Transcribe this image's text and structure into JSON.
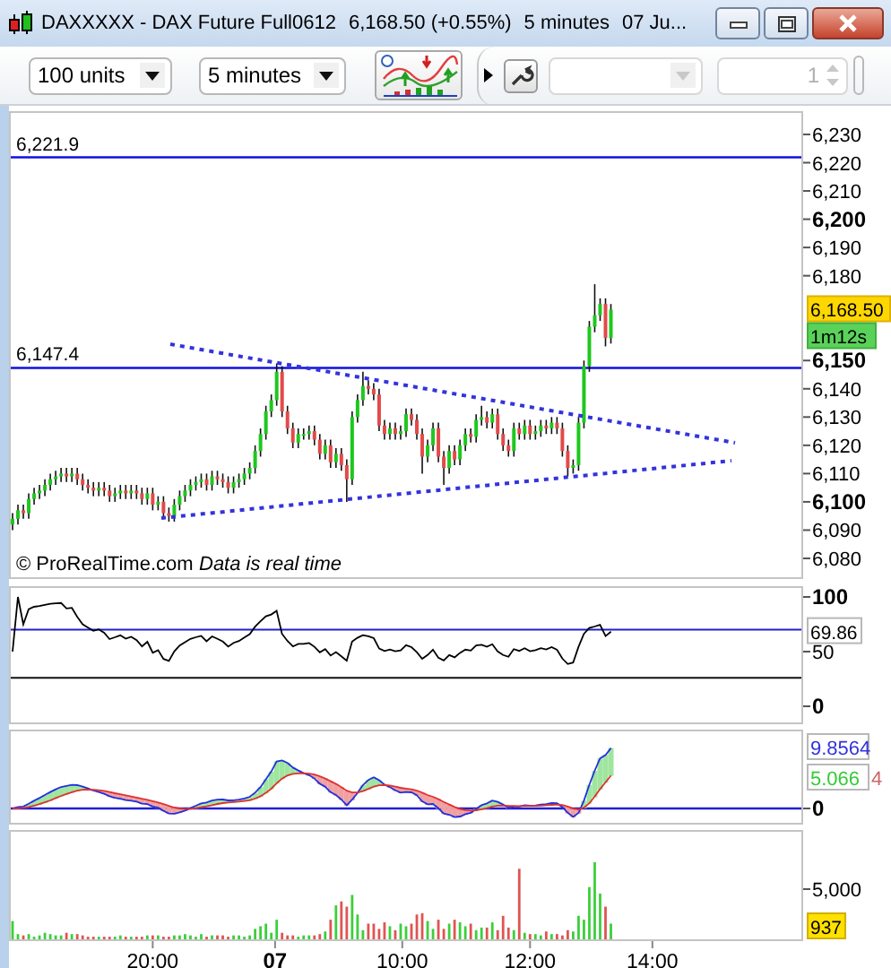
{
  "window": {
    "title": "DAXXXXX - DAX Future Full0612",
    "quote": "6,168.50 (+0.55%)",
    "timeframe": "5 minutes",
    "date": "07 Ju..."
  },
  "toolbar": {
    "units": "100 units",
    "period": "5 minutes",
    "style_dropdown": {
      "disabled": true
    },
    "quantity": {
      "value": "1",
      "disabled": true
    }
  },
  "price_chart": {
    "copyright": "© ProRealTime.com",
    "notice": "Data is real time",
    "last_price": "6,168.50",
    "countdown": "1m12s",
    "chart_data": {
      "type": "candlestick",
      "ylim": [
        6072.7,
        6237.6
      ],
      "categories": [
        null,
        null,
        null,
        null,
        null,
        null,
        null,
        null,
        null,
        null,
        null,
        null,
        null,
        null,
        null,
        null,
        null,
        null,
        null,
        null,
        null,
        null,
        null,
        null,
        null,
        null,
        null,
        null,
        null,
        null,
        null,
        null,
        null,
        null,
        null,
        null,
        null,
        null,
        null,
        null,
        null,
        null,
        null,
        null,
        null,
        null,
        null,
        null,
        null,
        null,
        null,
        null,
        null,
        null,
        null,
        null,
        null,
        null,
        null,
        null,
        null,
        null,
        null,
        null,
        null,
        null,
        null,
        null,
        null,
        null,
        null,
        null,
        null,
        null,
        null,
        null,
        null,
        null,
        null,
        null,
        null,
        null,
        null,
        null,
        null,
        null,
        null,
        null,
        null,
        null,
        null,
        null,
        null,
        null,
        null,
        null,
        null,
        null,
        null,
        null,
        null,
        null,
        null,
        null,
        null,
        null,
        null,
        null,
        null,
        null,
        null,
        null,
        null,
        null,
        null,
        null,
        null,
        null,
        null,
        null,
        null,
        null,
        null,
        null,
        null,
        null,
        null,
        null,
        null,
        null,
        null,
        null,
        null,
        null,
        null,
        null,
        null,
        null,
        null,
        null,
        null,
        null,
        null,
        null,
        null,
        null,
        null
      ],
      "ohlc": [
        [
          6092,
          6096,
          6090,
          6094
        ],
        [
          6094,
          6099,
          6092,
          6097
        ],
        [
          6097,
          6099,
          6094,
          6096
        ],
        [
          6096,
          6103,
          6094,
          6101
        ],
        [
          6101,
          6105,
          6099,
          6103
        ],
        [
          6103,
          6106,
          6101,
          6104
        ],
        [
          6104,
          6108,
          6102,
          6106
        ],
        [
          6106,
          6110,
          6104,
          6108
        ],
        [
          6108,
          6111,
          6106,
          6109
        ],
        [
          6109,
          6112,
          6107,
          6110
        ],
        [
          6110,
          6112,
          6107,
          6109
        ],
        [
          6109,
          6112,
          6107,
          6110
        ],
        [
          6110,
          6112,
          6106,
          6108
        ],
        [
          6108,
          6110,
          6104,
          6106
        ],
        [
          6106,
          6108,
          6103,
          6105
        ],
        [
          6105,
          6107,
          6102,
          6104
        ],
        [
          6104,
          6107,
          6102,
          6105
        ],
        [
          6105,
          6107,
          6102,
          6104
        ],
        [
          6104,
          6106,
          6100,
          6102
        ],
        [
          6102,
          6105,
          6100,
          6103
        ],
        [
          6103,
          6106,
          6101,
          6104
        ],
        [
          6104,
          6106,
          6101,
          6103
        ],
        [
          6103,
          6106,
          6101,
          6104
        ],
        [
          6104,
          6106,
          6101,
          6103
        ],
        [
          6103,
          6105,
          6099,
          6101
        ],
        [
          6101,
          6105,
          6099,
          6103
        ],
        [
          6103,
          6105,
          6097,
          6099
        ],
        [
          6099,
          6102,
          6097,
          6100
        ],
        [
          6100,
          6102,
          6094,
          6096
        ],
        [
          6096,
          6098,
          6093,
          6095
        ],
        [
          6095,
          6101,
          6093,
          6099
        ],
        [
          6099,
          6104,
          6097,
          6102
        ],
        [
          6102,
          6106,
          6100,
          6104
        ],
        [
          6104,
          6108,
          6102,
          6106
        ],
        [
          6106,
          6109,
          6104,
          6107
        ],
        [
          6107,
          6110,
          6105,
          6108
        ],
        [
          6108,
          6110,
          6104,
          6106
        ],
        [
          6106,
          6111,
          6104,
          6109
        ],
        [
          6109,
          6111,
          6106,
          6108
        ],
        [
          6108,
          6110,
          6105,
          6107
        ],
        [
          6107,
          6109,
          6103,
          6105
        ],
        [
          6105,
          6109,
          6103,
          6107
        ],
        [
          6107,
          6110,
          6105,
          6108
        ],
        [
          6108,
          6112,
          6106,
          6110
        ],
        [
          6110,
          6114,
          6108,
          6112
        ],
        [
          6112,
          6120,
          6110,
          6118
        ],
        [
          6118,
          6126,
          6116,
          6124
        ],
        [
          6124,
          6134,
          6122,
          6132
        ],
        [
          6132,
          6138,
          6130,
          6136
        ],
        [
          6136,
          6149,
          6134,
          6146
        ],
        [
          6146,
          6148,
          6130,
          6132
        ],
        [
          6132,
          6134,
          6124,
          6126
        ],
        [
          6126,
          6128,
          6119,
          6121
        ],
        [
          6121,
          6126,
          6119,
          6124
        ],
        [
          6124,
          6126,
          6122,
          6124
        ],
        [
          6124,
          6127,
          6122,
          6125
        ],
        [
          6125,
          6127,
          6120,
          6122
        ],
        [
          6122,
          6124,
          6115,
          6117
        ],
        [
          6117,
          6122,
          6115,
          6120
        ],
        [
          6120,
          6122,
          6112,
          6114
        ],
        [
          6114,
          6119,
          6112,
          6117
        ],
        [
          6117,
          6119,
          6111,
          6113
        ],
        [
          6113,
          6115,
          6100,
          6108
        ],
        [
          6108,
          6132,
          6106,
          6130
        ],
        [
          6130,
          6138,
          6128,
          6136
        ],
        [
          6136,
          6146,
          6134,
          6141
        ],
        [
          6141,
          6143,
          6138,
          6140
        ],
        [
          6140,
          6142,
          6136,
          6138
        ],
        [
          6138,
          6140,
          6125,
          6127
        ],
        [
          6127,
          6129,
          6122,
          6124
        ],
        [
          6124,
          6128,
          6122,
          6126
        ],
        [
          6126,
          6128,
          6122,
          6124
        ],
        [
          6124,
          6127,
          6122,
          6125
        ],
        [
          6125,
          6133,
          6123,
          6131
        ],
        [
          6131,
          6133,
          6127,
          6129
        ],
        [
          6129,
          6131,
          6122,
          6124
        ],
        [
          6124,
          6126,
          6110,
          6116
        ],
        [
          6116,
          6122,
          6114,
          6120
        ],
        [
          6120,
          6128,
          6118,
          6126
        ],
        [
          6126,
          6128,
          6114,
          6116
        ],
        [
          6116,
          6118,
          6106,
          6112
        ],
        [
          6112,
          6120,
          6110,
          6118
        ],
        [
          6118,
          6120,
          6113,
          6115
        ],
        [
          6115,
          6122,
          6113,
          6120
        ],
        [
          6120,
          6126,
          6118,
          6124
        ],
        [
          6124,
          6126,
          6121,
          6123
        ],
        [
          6123,
          6131,
          6121,
          6129
        ],
        [
          6129,
          6134,
          6127,
          6130
        ],
        [
          6130,
          6132,
          6126,
          6128
        ],
        [
          6128,
          6133,
          6126,
          6131
        ],
        [
          6131,
          6133,
          6122,
          6124
        ],
        [
          6124,
          6126,
          6118,
          6120
        ],
        [
          6120,
          6122,
          6116,
          6118
        ],
        [
          6118,
          6128,
          6116,
          6126
        ],
        [
          6126,
          6128,
          6122,
          6124
        ],
        [
          6124,
          6129,
          6122,
          6127
        ],
        [
          6127,
          6129,
          6122,
          6124
        ],
        [
          6124,
          6127,
          6122,
          6125
        ],
        [
          6125,
          6129,
          6123,
          6127
        ],
        [
          6127,
          6129,
          6124,
          6126
        ],
        [
          6126,
          6130,
          6124,
          6128
        ],
        [
          6128,
          6130,
          6124,
          6126
        ],
        [
          6126,
          6128,
          6116,
          6118
        ],
        [
          6118,
          6120,
          6109,
          6112
        ],
        [
          6112,
          6115,
          6110,
          6113
        ],
        [
          6113,
          6130,
          6111,
          6128
        ],
        [
          6128,
          6150,
          6126,
          6148
        ],
        [
          6148,
          6164,
          6146,
          6162
        ],
        [
          6162,
          6177,
          6160,
          6166
        ],
        [
          6166,
          6172,
          6164,
          6170
        ],
        [
          6170,
          6172,
          6155,
          6158
        ],
        [
          6158,
          6170,
          6156,
          6168
        ],
        null,
        null,
        null,
        null,
        null,
        null,
        null,
        null,
        null,
        null,
        null,
        null,
        null,
        null,
        null,
        null,
        null,
        null,
        null,
        null,
        null,
        null,
        null,
        null,
        null,
        null,
        null,
        null,
        null,
        null,
        null,
        null,
        null,
        null,
        null
      ],
      "yticks": [
        {
          "value": 6080,
          "label": "6,080"
        },
        {
          "value": 6090,
          "label": "6,090"
        },
        {
          "value": 6100,
          "label": "6,100"
        },
        {
          "value": 6110,
          "label": "6,110"
        },
        {
          "value": 6120,
          "label": "6,120"
        },
        {
          "value": 6130,
          "label": "6,130"
        },
        {
          "value": 6140,
          "label": "6,140"
        },
        {
          "value": 6150,
          "label": "6,150"
        },
        {
          "value": 6180,
          "label": "6,180"
        },
        {
          "value": 6190,
          "label": "6,190"
        },
        {
          "value": 6200,
          "label": "6,200"
        },
        {
          "value": 6210,
          "label": "6,210"
        },
        {
          "value": 6220,
          "label": "6,220"
        },
        {
          "value": 6230,
          "label": "6,230"
        }
      ],
      "ref_lines": [
        {
          "axis": "y",
          "value": 6221.9,
          "label": "6,221.9"
        },
        {
          "axis": "y",
          "value": 6147.4,
          "label": "6,147.4"
        }
      ]
    }
  },
  "rsi": {
    "reading": "69.86",
    "axis_labels": [
      "100",
      "50",
      "0"
    ]
  },
  "macd": {
    "labels": [
      {
        "text": "9.8564",
        "color": "#3333dd",
        "kind": "box"
      },
      {
        "text": "5.066",
        "color": "#33cc33",
        "kind": "box"
      },
      {
        "text": "4",
        "color": "#cc6666",
        "kind": "peek"
      }
    ],
    "zero_label": "0"
  },
  "volume": {
    "last_volume": "937",
    "scale_label": "5,000",
    "time_axis": [
      {
        "label": "20:00",
        "kind": "time"
      },
      {
        "label": "07",
        "kind": "day"
      },
      {
        "label": "10:00",
        "kind": "time"
      },
      {
        "label": "12:00",
        "kind": "time"
      },
      {
        "label": "14:00",
        "kind": "time"
      }
    ]
  }
}
